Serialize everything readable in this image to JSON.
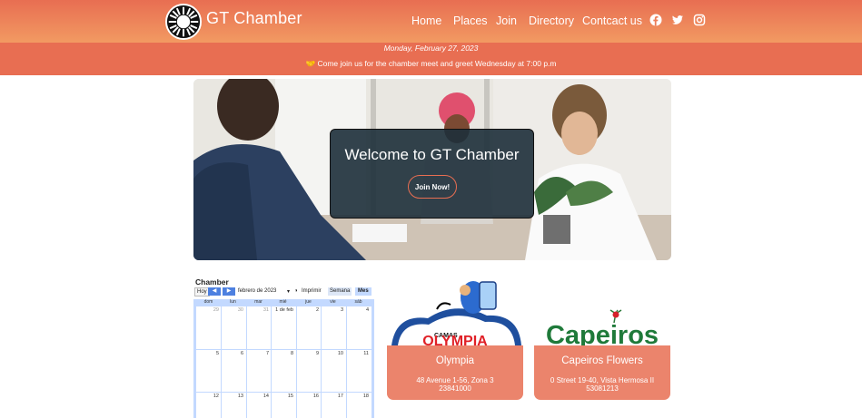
{
  "header": {
    "brand": "GT Chamber",
    "nav": [
      "Home",
      "Places",
      "Join",
      "Directory",
      "Contcact us"
    ],
    "social_icons": [
      "facebook-icon",
      "twitter-icon",
      "instagram-icon"
    ]
  },
  "banner": {
    "date": "Monday, February 27, 2023",
    "message": "Come join us for the chamber meet and greet Wednesday at 7:00 p.m"
  },
  "hero": {
    "title": "Welcome to GT Chamber",
    "button": "Join Now!"
  },
  "calendar": {
    "title": "Chamber",
    "today_button": "Hoy",
    "prev_icon": "chevron-left-icon",
    "next_icon": "chevron-right-icon",
    "month_label": "febrero de 2023",
    "print_label": "Imprimir",
    "week_tab": "Semana",
    "month_tab": "Mes",
    "weekdays": [
      "dom",
      "lun",
      "mar",
      "mié",
      "jue",
      "vie",
      "sáb"
    ],
    "weeks": [
      [
        "29",
        "30",
        "31",
        "1 de feb",
        "2",
        "3",
        "4"
      ],
      [
        "5",
        "6",
        "7",
        "8",
        "9",
        "10",
        "11"
      ],
      [
        "12",
        "13",
        "14",
        "15",
        "16",
        "17",
        "18"
      ]
    ]
  },
  "businesses": [
    {
      "logo_text": "CAMAS OLYMPIA",
      "name": "Olympia",
      "address": "48 Avenue 1-56, Zona 3",
      "phone": "23841000"
    },
    {
      "logo_text": "Capeiros",
      "name": "Capeiros Flowers",
      "address": "0 Street 19-40, Vista Hermosa II",
      "phone": "53081213"
    }
  ],
  "colors": {
    "accent": "#e86e52",
    "header_gradient_end": "#f29a62",
    "hero_card": "#1d2f3a",
    "calendar_blue": "#c3d9ff"
  }
}
